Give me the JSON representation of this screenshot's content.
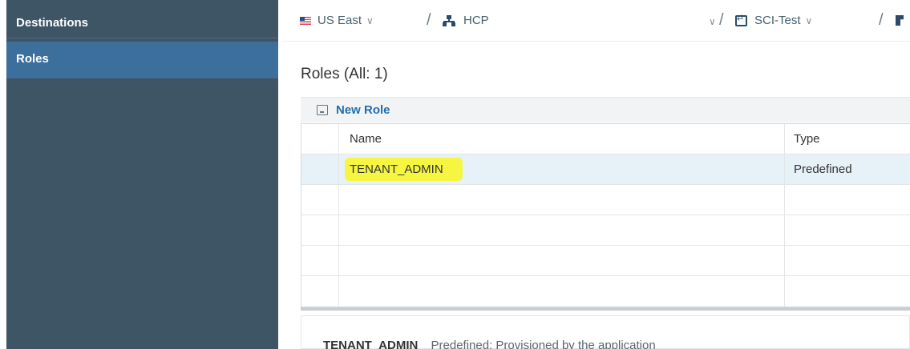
{
  "sidebar": {
    "items": [
      {
        "label": "Destinations"
      },
      {
        "label": "Roles"
      }
    ]
  },
  "breadcrumb": {
    "region": "US East",
    "platform": "HCP",
    "subaccount": "SCI-Test"
  },
  "page": {
    "title": "Roles (All: 1)"
  },
  "toolbar": {
    "new_role_label": "New Role"
  },
  "table": {
    "columns": [
      "Name",
      "Type"
    ],
    "rows": [
      {
        "name": "TENANT_ADMIN",
        "type": "Predefined"
      }
    ]
  },
  "detail": {
    "name": "TENANT_ADMIN",
    "description": "Predefined: Provisioned by the application"
  },
  "colors": {
    "sidebar_bg": "#3e5566",
    "sidebar_active": "#3d6f9c",
    "link_blue": "#1f6fb0",
    "highlight": "#f5f542",
    "selected_row": "#e7f1f8"
  }
}
